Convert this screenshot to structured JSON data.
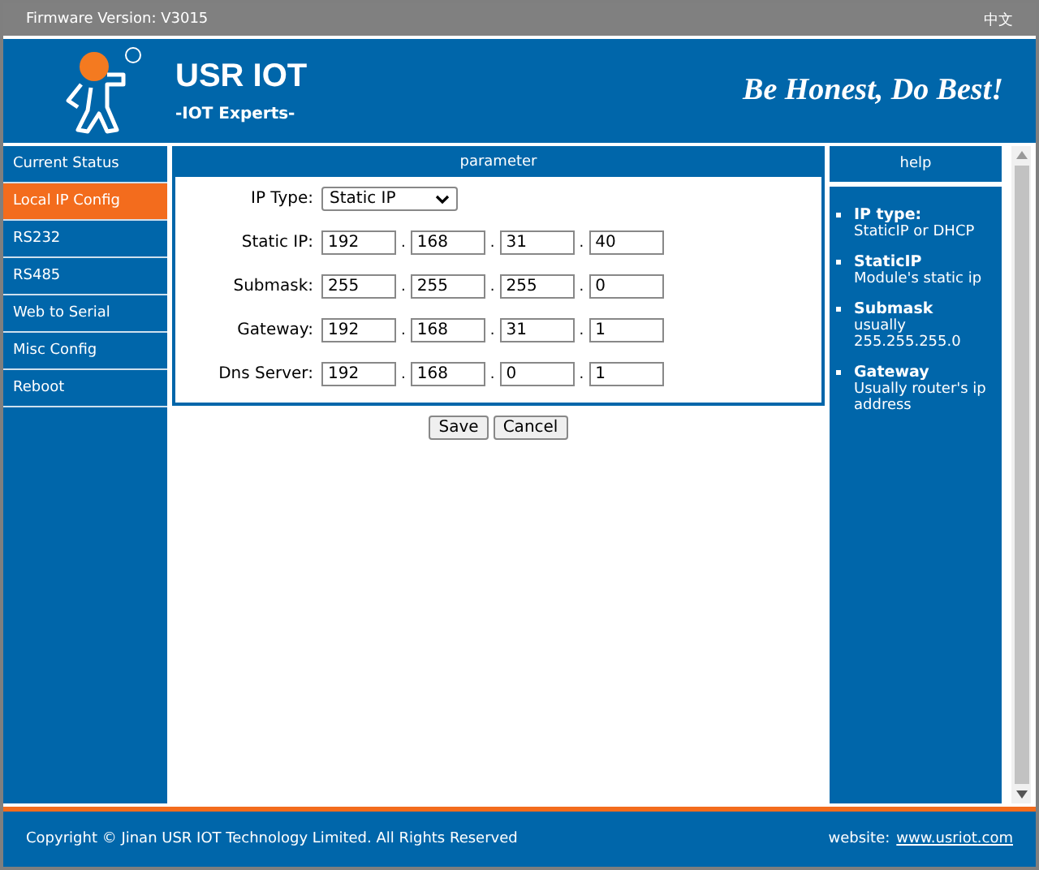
{
  "top_bar": {
    "firmware_label": "Firmware Version:",
    "firmware_version": "V3015",
    "language": "中文"
  },
  "header": {
    "brand": "USR IOT",
    "tagline": "-IOT Experts-",
    "slogan": "Be Honest, Do Best!"
  },
  "sidebar": {
    "items": [
      {
        "label": "Current Status",
        "selected": false
      },
      {
        "label": "Local IP Config",
        "selected": true
      },
      {
        "label": "RS232",
        "selected": false
      },
      {
        "label": "RS485",
        "selected": false
      },
      {
        "label": "Web to Serial",
        "selected": false
      },
      {
        "label": "Misc Config",
        "selected": false
      },
      {
        "label": "Reboot",
        "selected": false
      }
    ]
  },
  "parameter": {
    "title": "parameter",
    "ip_type": {
      "label": "IP Type:",
      "value": "Static IP"
    },
    "rows": [
      {
        "label": "Static IP:",
        "separator": ".",
        "octets": [
          "192",
          "168",
          "31",
          "40"
        ]
      },
      {
        "label": "Submask:",
        "separator": ".",
        "octets": [
          "255",
          "255",
          "255",
          "0"
        ]
      },
      {
        "label": "Gateway:",
        "separator": ".",
        "octets": [
          "192",
          "168",
          "31",
          "1"
        ]
      },
      {
        "label": "Dns Server:",
        "separator": ".",
        "octets": [
          "192",
          "168",
          "0",
          "1"
        ]
      }
    ],
    "buttons": [
      "Save",
      "Cancel"
    ]
  },
  "help": {
    "title": "help",
    "items": [
      {
        "term": "IP type:",
        "desc": "StaticIP or DHCP"
      },
      {
        "term": "StaticIP",
        "desc": "Module's static ip"
      },
      {
        "term": "Submask",
        "desc": "usually 255.255.255.0"
      },
      {
        "term": "Gateway",
        "desc": "Usually router's ip address"
      }
    ]
  },
  "footer": {
    "copyright": "Copyright © Jinan USR IOT Technology Limited. All Rights Reserved",
    "website_label": "website:",
    "website_link": "www.usriot.com"
  }
}
